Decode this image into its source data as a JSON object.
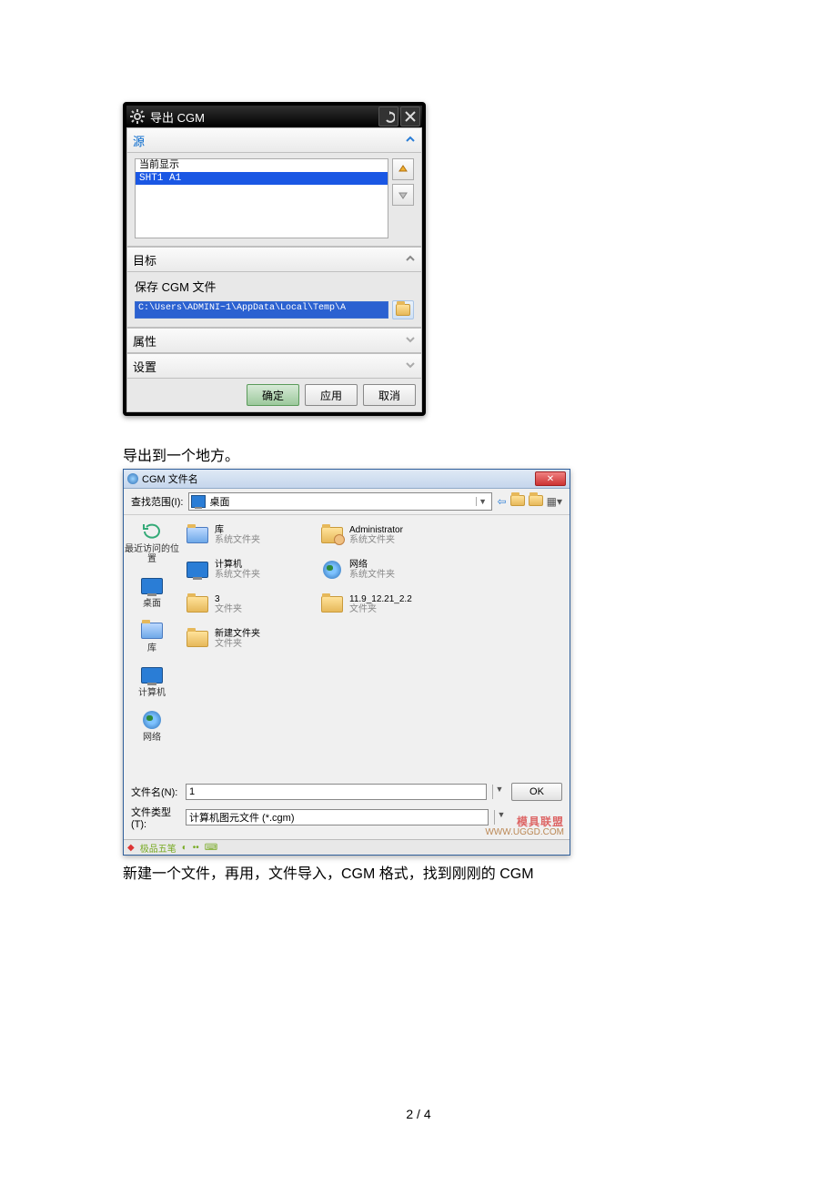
{
  "dialog1": {
    "title": "导出 CGM",
    "sections": {
      "source": {
        "title": "源"
      },
      "target": {
        "title": "目标",
        "save_label": "保存 CGM 文件",
        "path": "C:\\Users\\ADMINI~1\\AppData\\Local\\Temp\\A"
      },
      "props": {
        "title": "属性"
      },
      "settings": {
        "title": "设置"
      }
    },
    "source_list": {
      "line1": "当前显示",
      "line2": "SHT1  A1"
    },
    "buttons": {
      "ok": "确定",
      "apply": "应用",
      "cancel": "取消"
    }
  },
  "caption1": "导出到一个地方。",
  "dialog2": {
    "title": "CGM 文件名",
    "look_in_label": "查找范围(I):",
    "look_in_value": "桌面",
    "places": {
      "recent": "最近访问的位置",
      "desktop": "桌面",
      "library": "库",
      "computer": "计算机",
      "network": "网络"
    },
    "items": [
      {
        "name": "库",
        "sub": "系统文件夹",
        "icon": "lib"
      },
      {
        "name": "Administrator",
        "sub": "系统文件夹",
        "icon": "user"
      },
      {
        "name": "计算机",
        "sub": "系统文件夹",
        "icon": "pc"
      },
      {
        "name": "网络",
        "sub": "系统文件夹",
        "icon": "net"
      },
      {
        "name": "3",
        "sub": "文件夹",
        "icon": "folder"
      },
      {
        "name": "11.9_12.21_2.2",
        "sub": "文件夹",
        "icon": "folder"
      },
      {
        "name": "新建文件夹",
        "sub": "文件夹",
        "icon": "folder"
      }
    ],
    "filename_label": "文件名(N):",
    "filename_value": "1",
    "filetype_label": "文件类型(T):",
    "filetype_value": "计算机图元文件 (*.cgm)",
    "ok": "OK",
    "watermark": {
      "line1": "模具联盟",
      "line2": "WWW.UGGD.COM"
    },
    "ime": "极品五笔"
  },
  "caption2": "新建一个文件，再用，文件导入，CGM 格式，找到刚刚的 CGM",
  "page_number": "2  /  4"
}
